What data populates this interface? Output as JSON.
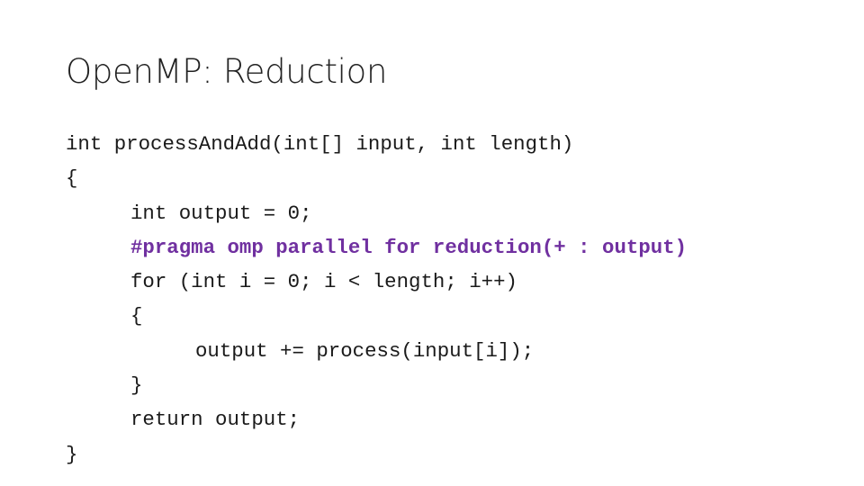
{
  "slide": {
    "title": "OpenMP: Reduction",
    "accent_color": "#7030A0",
    "code_lines": [
      {
        "text": "int processAndAdd(int[] input, int length)",
        "indent": 0,
        "highlight": false
      },
      {
        "text": "{",
        "indent": 0,
        "highlight": false
      },
      {
        "text": "int output = 0;",
        "indent": 1,
        "highlight": false
      },
      {
        "text": "#pragma omp parallel for reduction(+ : output)",
        "indent": 1,
        "highlight": true
      },
      {
        "text": "for (int i = 0; i < length; i++)",
        "indent": 1,
        "highlight": false
      },
      {
        "text": "{",
        "indent": 1,
        "highlight": false
      },
      {
        "text": "output += process(input[i]);",
        "indent": 2,
        "highlight": false
      },
      {
        "text": "}",
        "indent": 1,
        "highlight": false
      },
      {
        "text": "return output;",
        "indent": 1,
        "highlight": false
      },
      {
        "text": "}",
        "indent": 0,
        "highlight": false
      }
    ]
  }
}
